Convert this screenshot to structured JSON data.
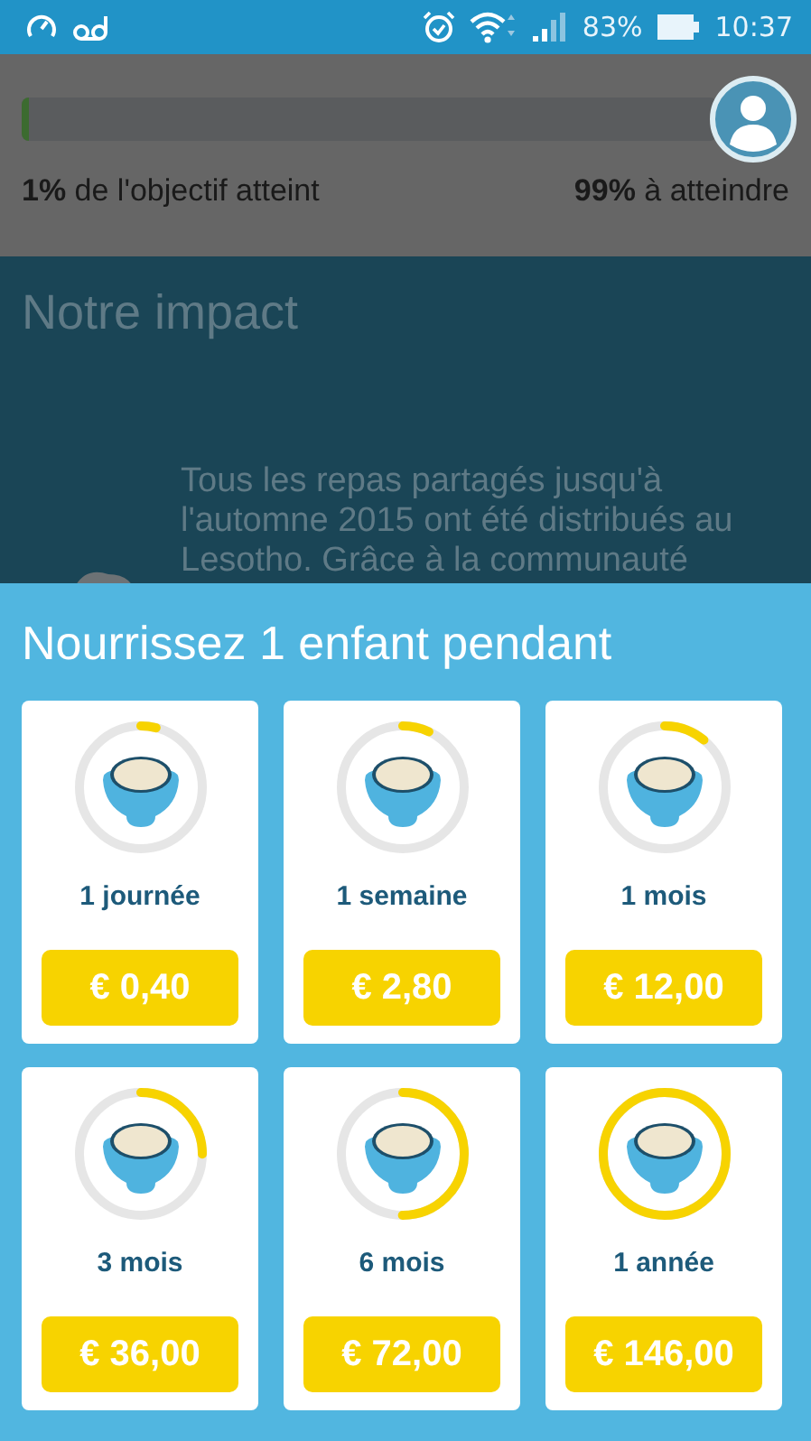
{
  "status_bar": {
    "battery_text": "83%",
    "time": "10:37"
  },
  "goal": {
    "level": 0.01,
    "reached_text": "**1%** de l'objectif atteint",
    "remaining_text": "**99%** à atteindre"
  },
  "impact": {
    "title": "Notre impact",
    "text": "Tous les repas partagés jusqu'à l'automne 2015 ont été distribués au Lesotho. Grâce à la communauté"
  },
  "sheet": {
    "title": "Nourrissez 1 enfant pendant",
    "options": [
      {
        "duration": "1 journée",
        "price": "€ 0,40"
      },
      {
        "duration": "1 semaine",
        "price": "€ 2,80"
      },
      {
        "duration": "1 mois",
        "price": "€ 12,00"
      },
      {
        "duration": "3 mois",
        "price": "€ 36,00"
      },
      {
        "duration": "6 mois",
        "price": "€ 72,00"
      },
      {
        "duration": "1 année",
        "price": "€ 146,00"
      }
    ]
  }
}
